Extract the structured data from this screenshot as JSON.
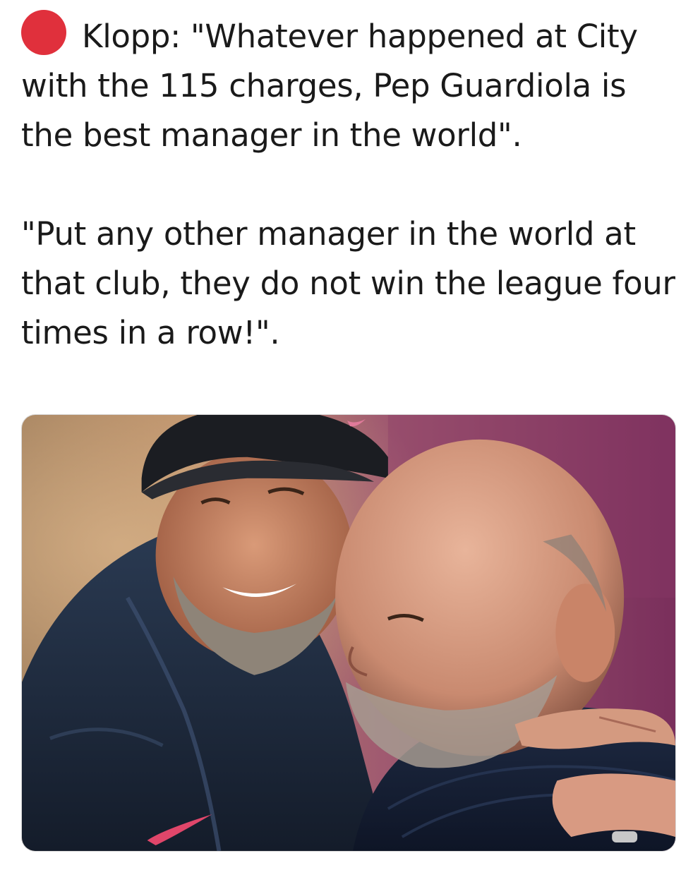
{
  "tweet": {
    "status_dot_color": "#e0303c",
    "paragraph_1": "Klopp: \"Whatever happened at City with the 115 charges, Pep Guardiola is the best manager in the world\".",
    "paragraph_2": "\"Put any other manager in the world at that club, they do not win the league four times in a row!\"."
  },
  "media": {
    "icon": "photo-of-two-managers-embracing"
  }
}
